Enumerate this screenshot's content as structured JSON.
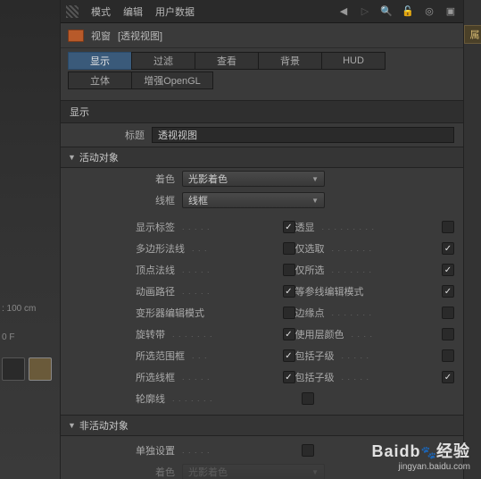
{
  "viewport_left": {
    "distance": ": 100 cm",
    "value": "0 F"
  },
  "right_strip": {
    "tab": "属"
  },
  "titlebar": {
    "menus": [
      "模式",
      "编辑",
      "用户数据"
    ],
    "icons": [
      "arrow-left",
      "arrow-right",
      "search",
      "lock",
      "target",
      "plus"
    ]
  },
  "header": {
    "title": "视窗",
    "subtitle": "[透视视图]"
  },
  "tabs": {
    "row1": [
      {
        "label": "显示",
        "active": true
      },
      {
        "label": "过滤",
        "active": false
      },
      {
        "label": "查看",
        "active": false
      },
      {
        "label": "背景",
        "active": false
      },
      {
        "label": "HUD",
        "active": false
      }
    ],
    "row2": [
      {
        "label": "立体",
        "active": false
      },
      {
        "label": "增强OpenGL",
        "active": false
      }
    ]
  },
  "section": {
    "title": "显示",
    "title_label": "标题",
    "title_value": "透视视图"
  },
  "active_objects": {
    "title": "活动对象",
    "shading_label": "着色",
    "shading_value": "光影着色",
    "wire_label": "线框",
    "wire_value": "线框",
    "rows": [
      {
        "l_label": "显示标签",
        "l_on": true,
        "r_label": "透显",
        "r_on": false
      },
      {
        "l_label": "多边形法线",
        "l_on": false,
        "r_label": "仅选取",
        "r_on": true
      },
      {
        "l_label": "顶点法线",
        "l_on": false,
        "r_label": "仅所选",
        "r_on": true
      },
      {
        "l_label": "动画路径",
        "l_on": true,
        "r_label": "等参线编辑模式",
        "r_on": true
      },
      {
        "l_label": "变形器编辑模式",
        "l_on": false,
        "r_label": "边缘点",
        "r_on": false
      },
      {
        "l_label": "旋转带",
        "l_on": true,
        "r_label": "使用层颜色",
        "r_on": false
      },
      {
        "l_label": "所选范围框",
        "l_on": true,
        "r_label": "包括子级",
        "r_on": false
      },
      {
        "l_label": "所选线框",
        "l_on": true,
        "r_label": "包括子级",
        "r_on": true
      }
    ],
    "outline_label": "轮廓线",
    "outline_on": false
  },
  "inactive_objects": {
    "title": "非活动对象",
    "single_label": "单独设置",
    "single_on": false,
    "shading_label": "着色",
    "shading_value": "光影着色"
  },
  "watermark": {
    "brand": "Baidb",
    "brand_cn": "经验",
    "url": "jingyan.baidu.com"
  }
}
